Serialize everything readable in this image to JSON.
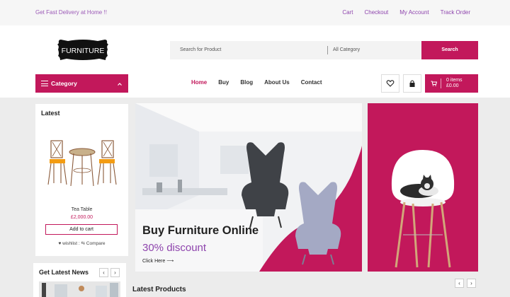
{
  "topbar": {
    "promo": "Get Fast Delivery at Home !!",
    "links": [
      "Cart",
      "Checkout",
      "My Account",
      "Track Order"
    ]
  },
  "header": {
    "logo_text": "FURNITURE",
    "search_placeholder": "Search for Product",
    "category_select": "All Category",
    "search_button": "Search"
  },
  "navbar": {
    "category_button": "Category",
    "items": [
      "Home",
      "Buy",
      "Blog",
      "About Us",
      "Contact"
    ],
    "active": "Home",
    "cart_items": "0 items",
    "cart_total": "£0.00"
  },
  "latest": {
    "title": "Latest",
    "product_name": "Tea Table",
    "product_price": "£2,000.00",
    "add_to_cart": "Add to cart",
    "wishlist": "wishlist",
    "compare": "Compare"
  },
  "news": {
    "title": "Get Latest News"
  },
  "hero": {
    "headline": "Buy Furniture Online",
    "discount": "30% discount",
    "cta": "Click Here"
  },
  "sections": {
    "latest_products": "Latest Products"
  },
  "colors": {
    "accent": "#c2185b",
    "purple_text": "#8e44ad",
    "background": "#ececec"
  }
}
